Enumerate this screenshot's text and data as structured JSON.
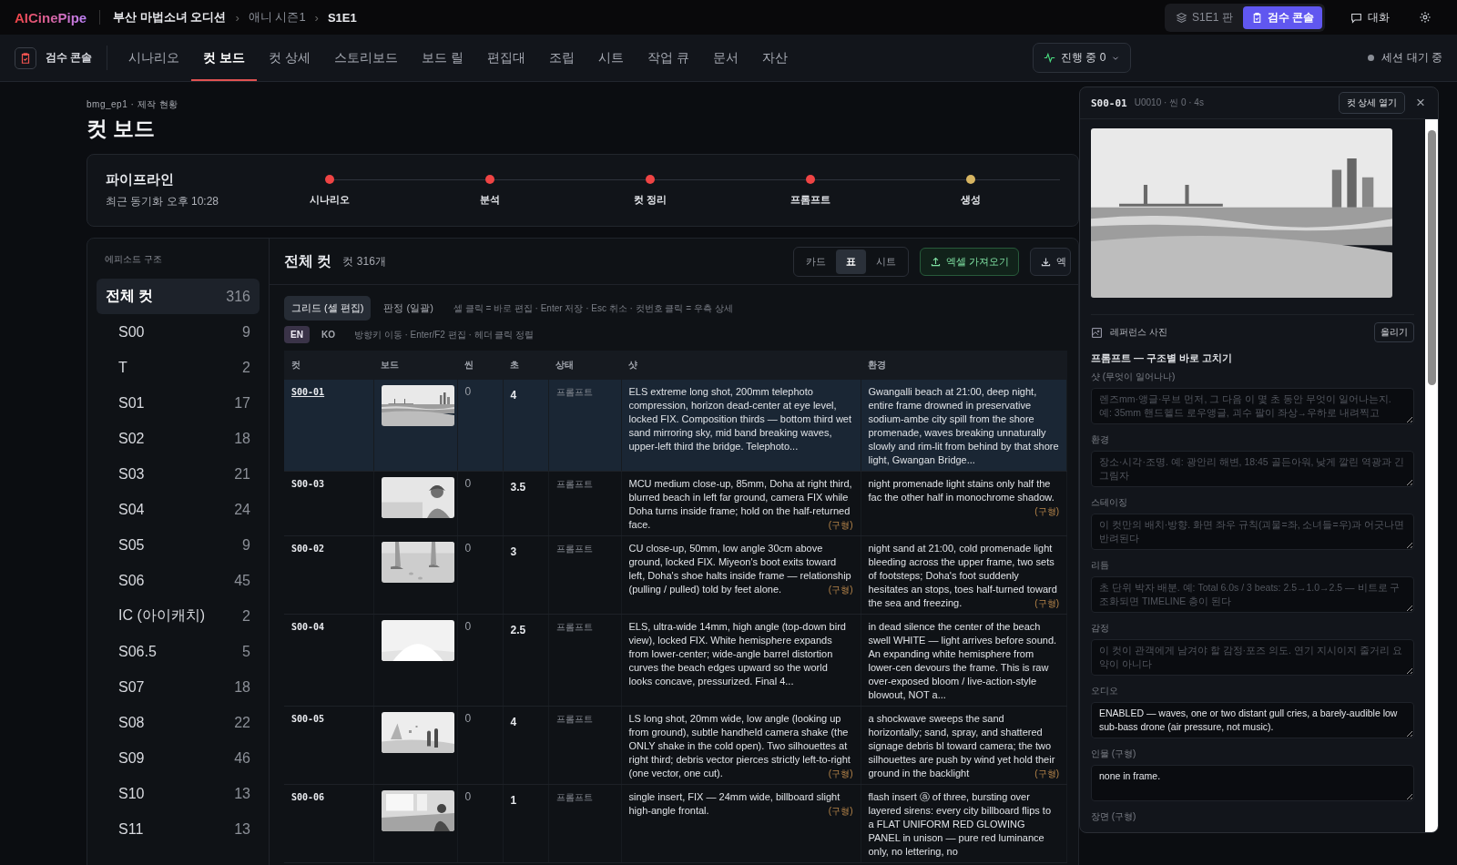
{
  "topbar": {
    "logo": "AICinePipe",
    "breadcrumbs": [
      "부산 마법소녀 오디션",
      "애니 시즌1",
      "S1E1"
    ],
    "separator": "›",
    "modes": [
      {
        "label": "S1E1 판",
        "selected": false
      },
      {
        "label": "검수 콘솔",
        "selected": true
      }
    ],
    "chat": "대화"
  },
  "nav": {
    "console": "검수 콘솔",
    "tabs": [
      {
        "label": "시나리오",
        "selected": false
      },
      {
        "label": "컷 보드",
        "selected": true
      },
      {
        "label": "컷 상세",
        "selected": false
      },
      {
        "label": "스토리보드",
        "selected": false
      },
      {
        "label": "보드 릴",
        "selected": false
      },
      {
        "label": "편집대",
        "selected": false
      },
      {
        "label": "조립",
        "selected": false
      },
      {
        "label": "시트",
        "selected": false
      },
      {
        "label": "작업 큐",
        "selected": false
      },
      {
        "label": "문서",
        "selected": false
      },
      {
        "label": "자산",
        "selected": false
      }
    ],
    "progress": "진행 중 0",
    "session": "세션 대기 중"
  },
  "page": {
    "breadcrumb": "bmg_ep1 · 제작 현황",
    "title": "컷 보드"
  },
  "pipeline": {
    "title": "파이프라인",
    "synced": "최근 동기화 오후 10:28",
    "steps": [
      {
        "label": "시나리오",
        "color": "#ef4444"
      },
      {
        "label": "분석",
        "color": "#ef4444"
      },
      {
        "label": "컷 정리",
        "color": "#ef4444"
      },
      {
        "label": "프롬프트",
        "color": "#ef4444"
      },
      {
        "label": "생성",
        "color": "#d6b461"
      }
    ]
  },
  "episodes": {
    "title": "에피소드 구조",
    "items": [
      {
        "label": "전체 컷",
        "count": "316",
        "selected": true
      },
      {
        "label": "S00",
        "count": "9",
        "selected": false
      },
      {
        "label": "T",
        "count": "2",
        "selected": false
      },
      {
        "label": "S01",
        "count": "17",
        "selected": false
      },
      {
        "label": "S02",
        "count": "18",
        "selected": false
      },
      {
        "label": "S03",
        "count": "21",
        "selected": false
      },
      {
        "label": "S04",
        "count": "24",
        "selected": false
      },
      {
        "label": "S05",
        "count": "9",
        "selected": false
      },
      {
        "label": "S06",
        "count": "45",
        "selected": false
      },
      {
        "label": "IC (아이캐치)",
        "count": "2",
        "selected": false
      },
      {
        "label": "S06.5",
        "count": "5",
        "selected": false
      },
      {
        "label": "S07",
        "count": "18",
        "selected": false
      },
      {
        "label": "S08",
        "count": "22",
        "selected": false
      },
      {
        "label": "S09",
        "count": "46",
        "selected": false
      },
      {
        "label": "S10",
        "count": "13",
        "selected": false
      },
      {
        "label": "S11",
        "count": "13",
        "selected": false
      }
    ]
  },
  "table_panel": {
    "title": "전체 컷",
    "count": "컷 316개",
    "views": [
      {
        "label": "카드",
        "selected": false
      },
      {
        "label": "표",
        "selected": true
      },
      {
        "label": "시트",
        "selected": false
      }
    ],
    "import": "엑셀 가져오기",
    "export": "엑",
    "modes": [
      {
        "label": "그리드 (셀 편집)",
        "selected": true
      },
      {
        "label": "판정 (일괄)",
        "selected": false
      }
    ],
    "mode_hint": "셀 클릭 = 바로 편집 · Enter 저장 · Esc 취소 · 컷번호 클릭 = 우측 상세",
    "langs": [
      {
        "label": "EN",
        "selected": true
      },
      {
        "label": "KO",
        "selected": false
      }
    ],
    "lang_hint": "방향키 이동 · Enter/F2 편집 · 헤더 클릭 정렬"
  },
  "table": {
    "columns": [
      "컷",
      "보드",
      "씬",
      "초",
      "상태",
      "샷",
      "환경"
    ],
    "rows": [
      {
        "cut": "S00-01",
        "scene": "0",
        "sec": "4",
        "status": "프롬프트",
        "selected": true,
        "shot": "ELS extreme long shot, 200mm telephoto compression, horizon dead-center at eye level, locked FIX. Composition thirds — bottom third wet sand mirroring sky, mid band breaking waves, upper-left third the bridge. Telephoto...",
        "env": "Gwangalli beach at 21:00, deep night, entire frame drowned in preservative sodium-ambe city spill from the shore promenade, waves breaking unnaturally slowly and rim-lit from behind by that shore light, Gwangan Bridge..."
      },
      {
        "cut": "S00-03",
        "scene": "0",
        "sec": "3.5",
        "status": "프롬프트",
        "selected": false,
        "shot": "MCU medium close-up, 85mm, Doha at right third, blurred beach in left far ground, camera FIX while Doha turns inside frame; hold on the half-returned face.",
        "shot_tag": "(구형)",
        "env": "night promenade light stains only half the fac the other half in monochrome shadow.",
        "env_tag": "(구형)"
      },
      {
        "cut": "S00-02",
        "scene": "0",
        "sec": "3",
        "status": "프롬프트",
        "selected": false,
        "shot": "CU close-up, 50mm, low angle 30cm above ground, locked FIX. Miyeon's boot exits toward left, Doha's shoe halts inside frame — relationship (pulling / pulled) told by feet alone.",
        "shot_tag": "(구형)",
        "env": "night sand at 21:00, cold promenade light bleeding across the upper frame, two sets of footsteps; Doha's foot suddenly hesitates an stops, toes half-turned toward the sea and freezing.",
        "env_tag": "(구형)"
      },
      {
        "cut": "S00-04",
        "scene": "0",
        "sec": "2.5",
        "status": "프롬프트",
        "selected": false,
        "shot": "ELS, ultra-wide 14mm, high angle (top-down bird view), locked FIX. White hemisphere expands from lower-center; wide-angle barrel distortion curves the beach edges upward so the world looks concave, pressurized. Final 4...",
        "env": "in dead silence the center of the beach swell WHITE — light arrives before sound. An expanding white hemisphere from lower-cen devours the frame. This is raw over-exposed bloom / live-action-style blowout, NOT a..."
      },
      {
        "cut": "S00-05",
        "scene": "0",
        "sec": "4",
        "status": "프롬프트",
        "selected": false,
        "shot": "LS long shot, 20mm wide, low angle (looking up from ground), subtle handheld camera shake (the ONLY shake in the cold open). Two silhouettes at right third; debris vector pierces strictly left-to-right (one vector, one cut).",
        "shot_tag": "(구형)",
        "env": "a shockwave sweeps the sand horizontally; sand, spray, and shattered signage debris bl toward camera; the two silhouettes are push by wind yet hold their ground in the backlight",
        "env_tag": "(구형)"
      },
      {
        "cut": "S00-06",
        "scene": "0",
        "sec": "1",
        "status": "프롬프트",
        "selected": false,
        "shot": "single insert, FIX — 24mm wide, billboard slight high-angle frontal.",
        "shot_tag": "(구형)",
        "env": "flash insert ⓐ of three, bursting over layered sirens: every city billboard flips to a FLAT UNIFORM RED GLOWING PANEL in unison — pure red luminance only, no lettering, no"
      }
    ]
  },
  "detail": {
    "cut": "S00-01",
    "meta": "U0010 · 씬 0 · 4s",
    "open": "컷 상세 열기",
    "close": "×",
    "reference": "레퍼런스 사진",
    "upload": "올리기",
    "section": "프롬프트 — 구조별 바로 고치기",
    "fields": [
      {
        "label": "샷 (무엇이 일어나나)",
        "placeholder": "렌즈mm·앵글·무브 먼저, 그 다음 이 몇 초 동안 무엇이 일어나는지. 예: 35mm 핸드헬드 로우앵글, 괴수 팔이 좌상→우하로 내려찍고"
      },
      {
        "label": "환경",
        "placeholder": "장소·시각·조명. 예: 광안리 해변, 18:45 골든아워, 낮게 깔린 역광과 긴 그림자"
      },
      {
        "label": "스테이징",
        "placeholder": "이 컷만의 배치·방향. 화면 좌우 규칙(괴물=좌, 소녀들=우)과 어긋나면 반려된다"
      },
      {
        "label": "리듬",
        "placeholder": "초 단위 박자 배분. 예: Total 6.0s / 3 beats: 2.5→1.0→2.5 — 비트로 구조화되면 TIMELINE 층이 된다"
      },
      {
        "label": "감정",
        "placeholder": "이 컷이 관객에게 남겨야 할 감정·포즈 의도. 연기 지시이지 줄거리 요약이 아니다"
      },
      {
        "label": "오디오",
        "value": "ENABLED — waves, one or two distant gull cries, a barely-audible low sub-bass drone (air pressure, not music)."
      },
      {
        "label": "인물 (구형)",
        "value": "none in frame."
      },
      {
        "label": "장면 (구형)"
      }
    ]
  }
}
